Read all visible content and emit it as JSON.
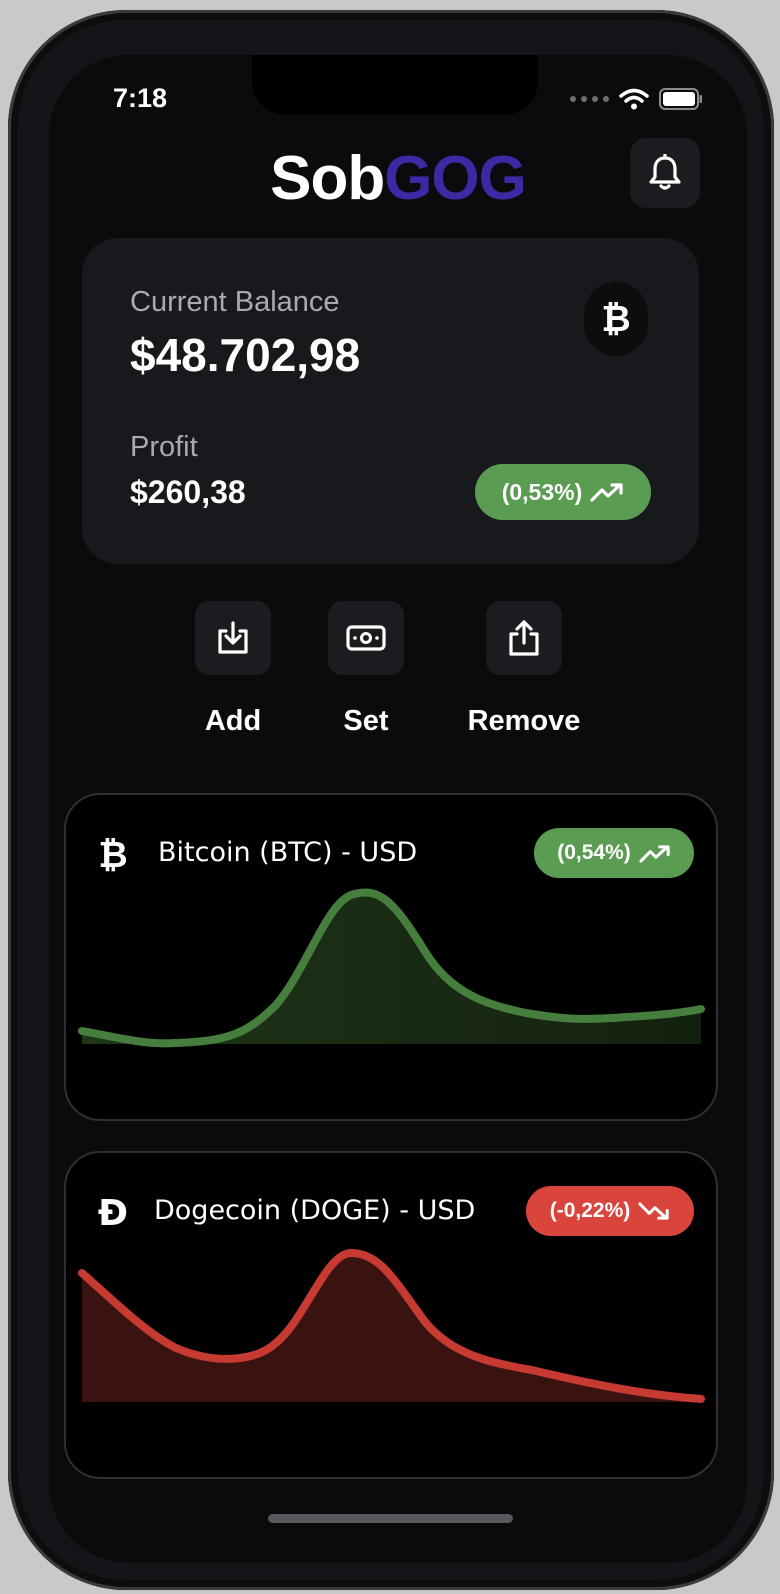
{
  "status_bar": {
    "time": "7:18"
  },
  "header": {
    "logo_part1": "Sob",
    "logo_part2": "GOG"
  },
  "balance": {
    "current_label": "Current Balance",
    "current_value": "$48.702,98",
    "profit_label": "Profit",
    "profit_value": "$260,38",
    "change": "(0,53%)"
  },
  "actions": [
    {
      "label": "Add",
      "icon": "download-icon"
    },
    {
      "label": "Set",
      "icon": "money-icon"
    },
    {
      "label": "Remove",
      "icon": "share-icon"
    }
  ],
  "coins": [
    {
      "name": "Bitcoin (BTC) - USD",
      "change": "(0,54%)",
      "trend": "up",
      "symbol": "bitcoin-icon"
    },
    {
      "name": "Dogecoin (DOGE) - USD",
      "change": "(-0,22%)",
      "trend": "down",
      "symbol": "dogecoin-icon"
    }
  ],
  "colors": {
    "background": "#0a0b0d",
    "card": "#18191d",
    "accent": "#3b2aa3",
    "positive": "#5a9c52",
    "negative": "#d9453c"
  }
}
